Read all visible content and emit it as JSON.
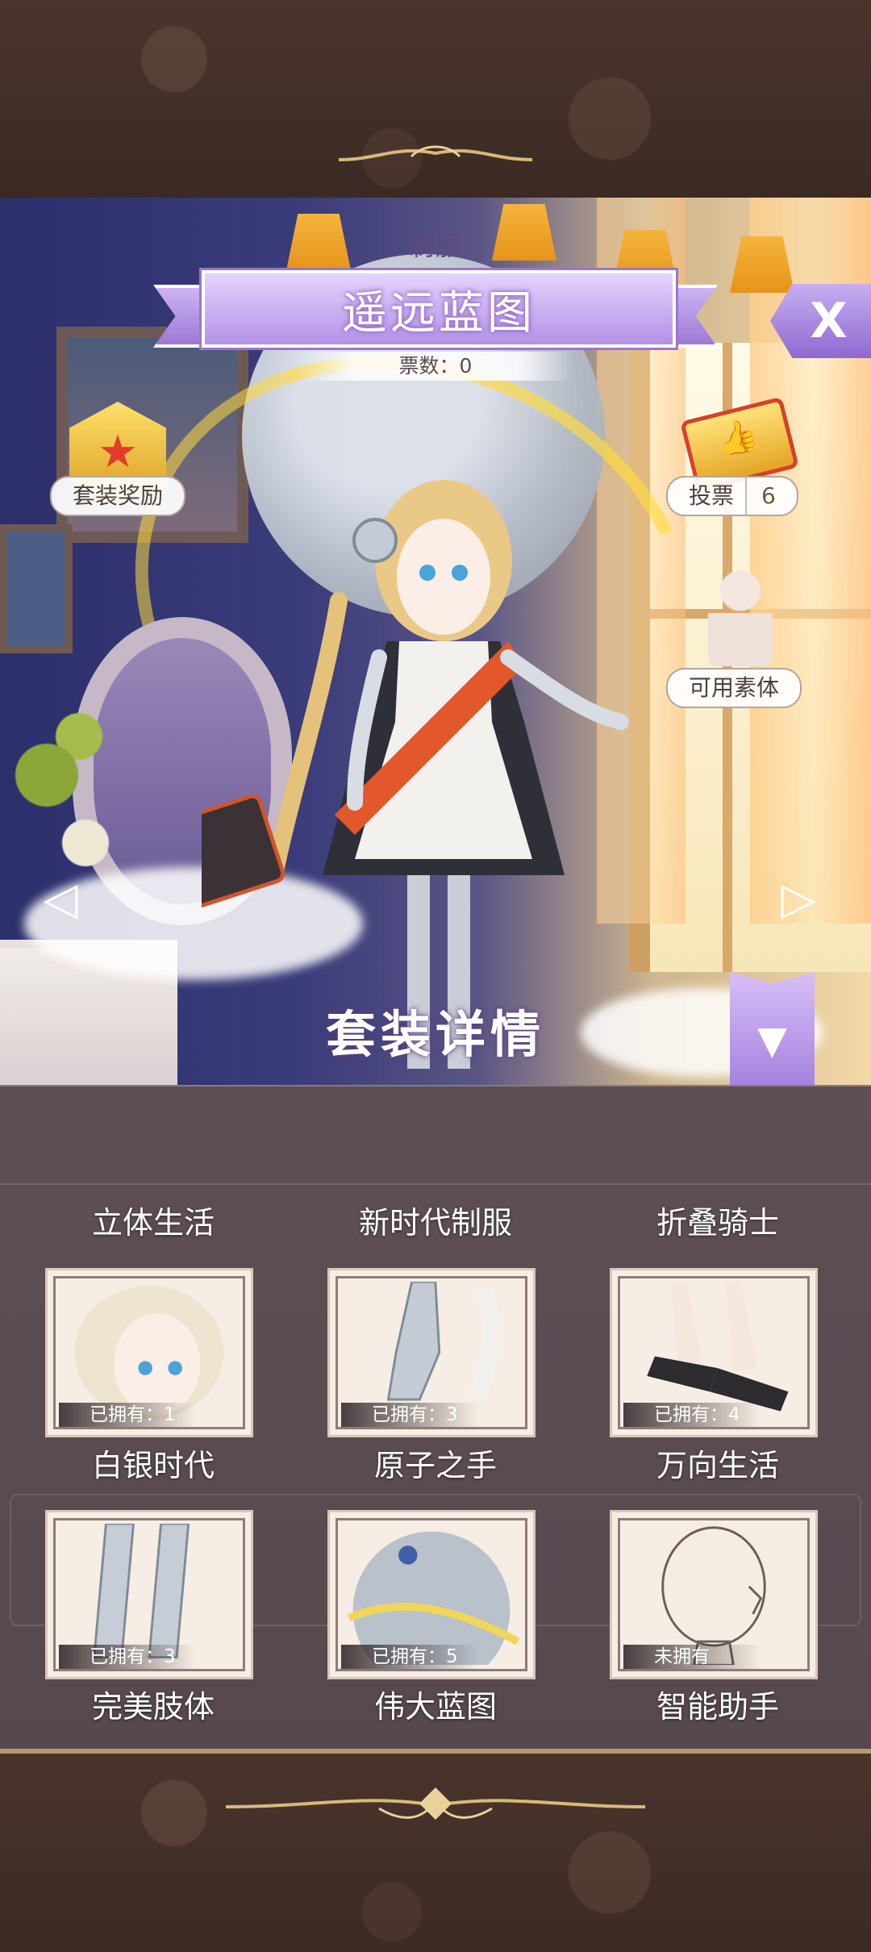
{
  "header": {
    "category": "制服",
    "set_name": "遥远蓝图",
    "votes_text": "票数：0",
    "close_label": "X"
  },
  "side": {
    "set_reward_label": "套装奖励",
    "vote_label": "投票",
    "vote_count": "6",
    "base_body_label": "可用素体"
  },
  "nav": {
    "prev_icon": "◁",
    "next_icon": "▷"
  },
  "set_details": {
    "title": "套装详情",
    "collapse_icon": "▼"
  },
  "columns": [
    "立体生活",
    "新时代制服",
    "折叠骑士"
  ],
  "items": [
    {
      "name": "白银时代",
      "owned": "已拥有：1",
      "icon": "hair-icon"
    },
    {
      "name": "原子之手",
      "owned": "已拥有：3",
      "icon": "mechanical-glove-icon"
    },
    {
      "name": "万向生活",
      "owned": "已拥有：4",
      "icon": "shoes-icon"
    },
    {
      "name": "完美肢体",
      "owned": "已拥有：3",
      "icon": "mechanical-legs-icon"
    },
    {
      "name": "伟大蓝图",
      "owned": "已拥有：5",
      "icon": "planet-background-icon"
    },
    {
      "name": "智能助手",
      "owned": "未拥有",
      "icon": "head-accessory-icon"
    }
  ],
  "colors": {
    "accent_purple": "#b491e6",
    "frame_brown": "#4a352c",
    "gold": "#b59a6c",
    "panel": "#5e5257"
  }
}
